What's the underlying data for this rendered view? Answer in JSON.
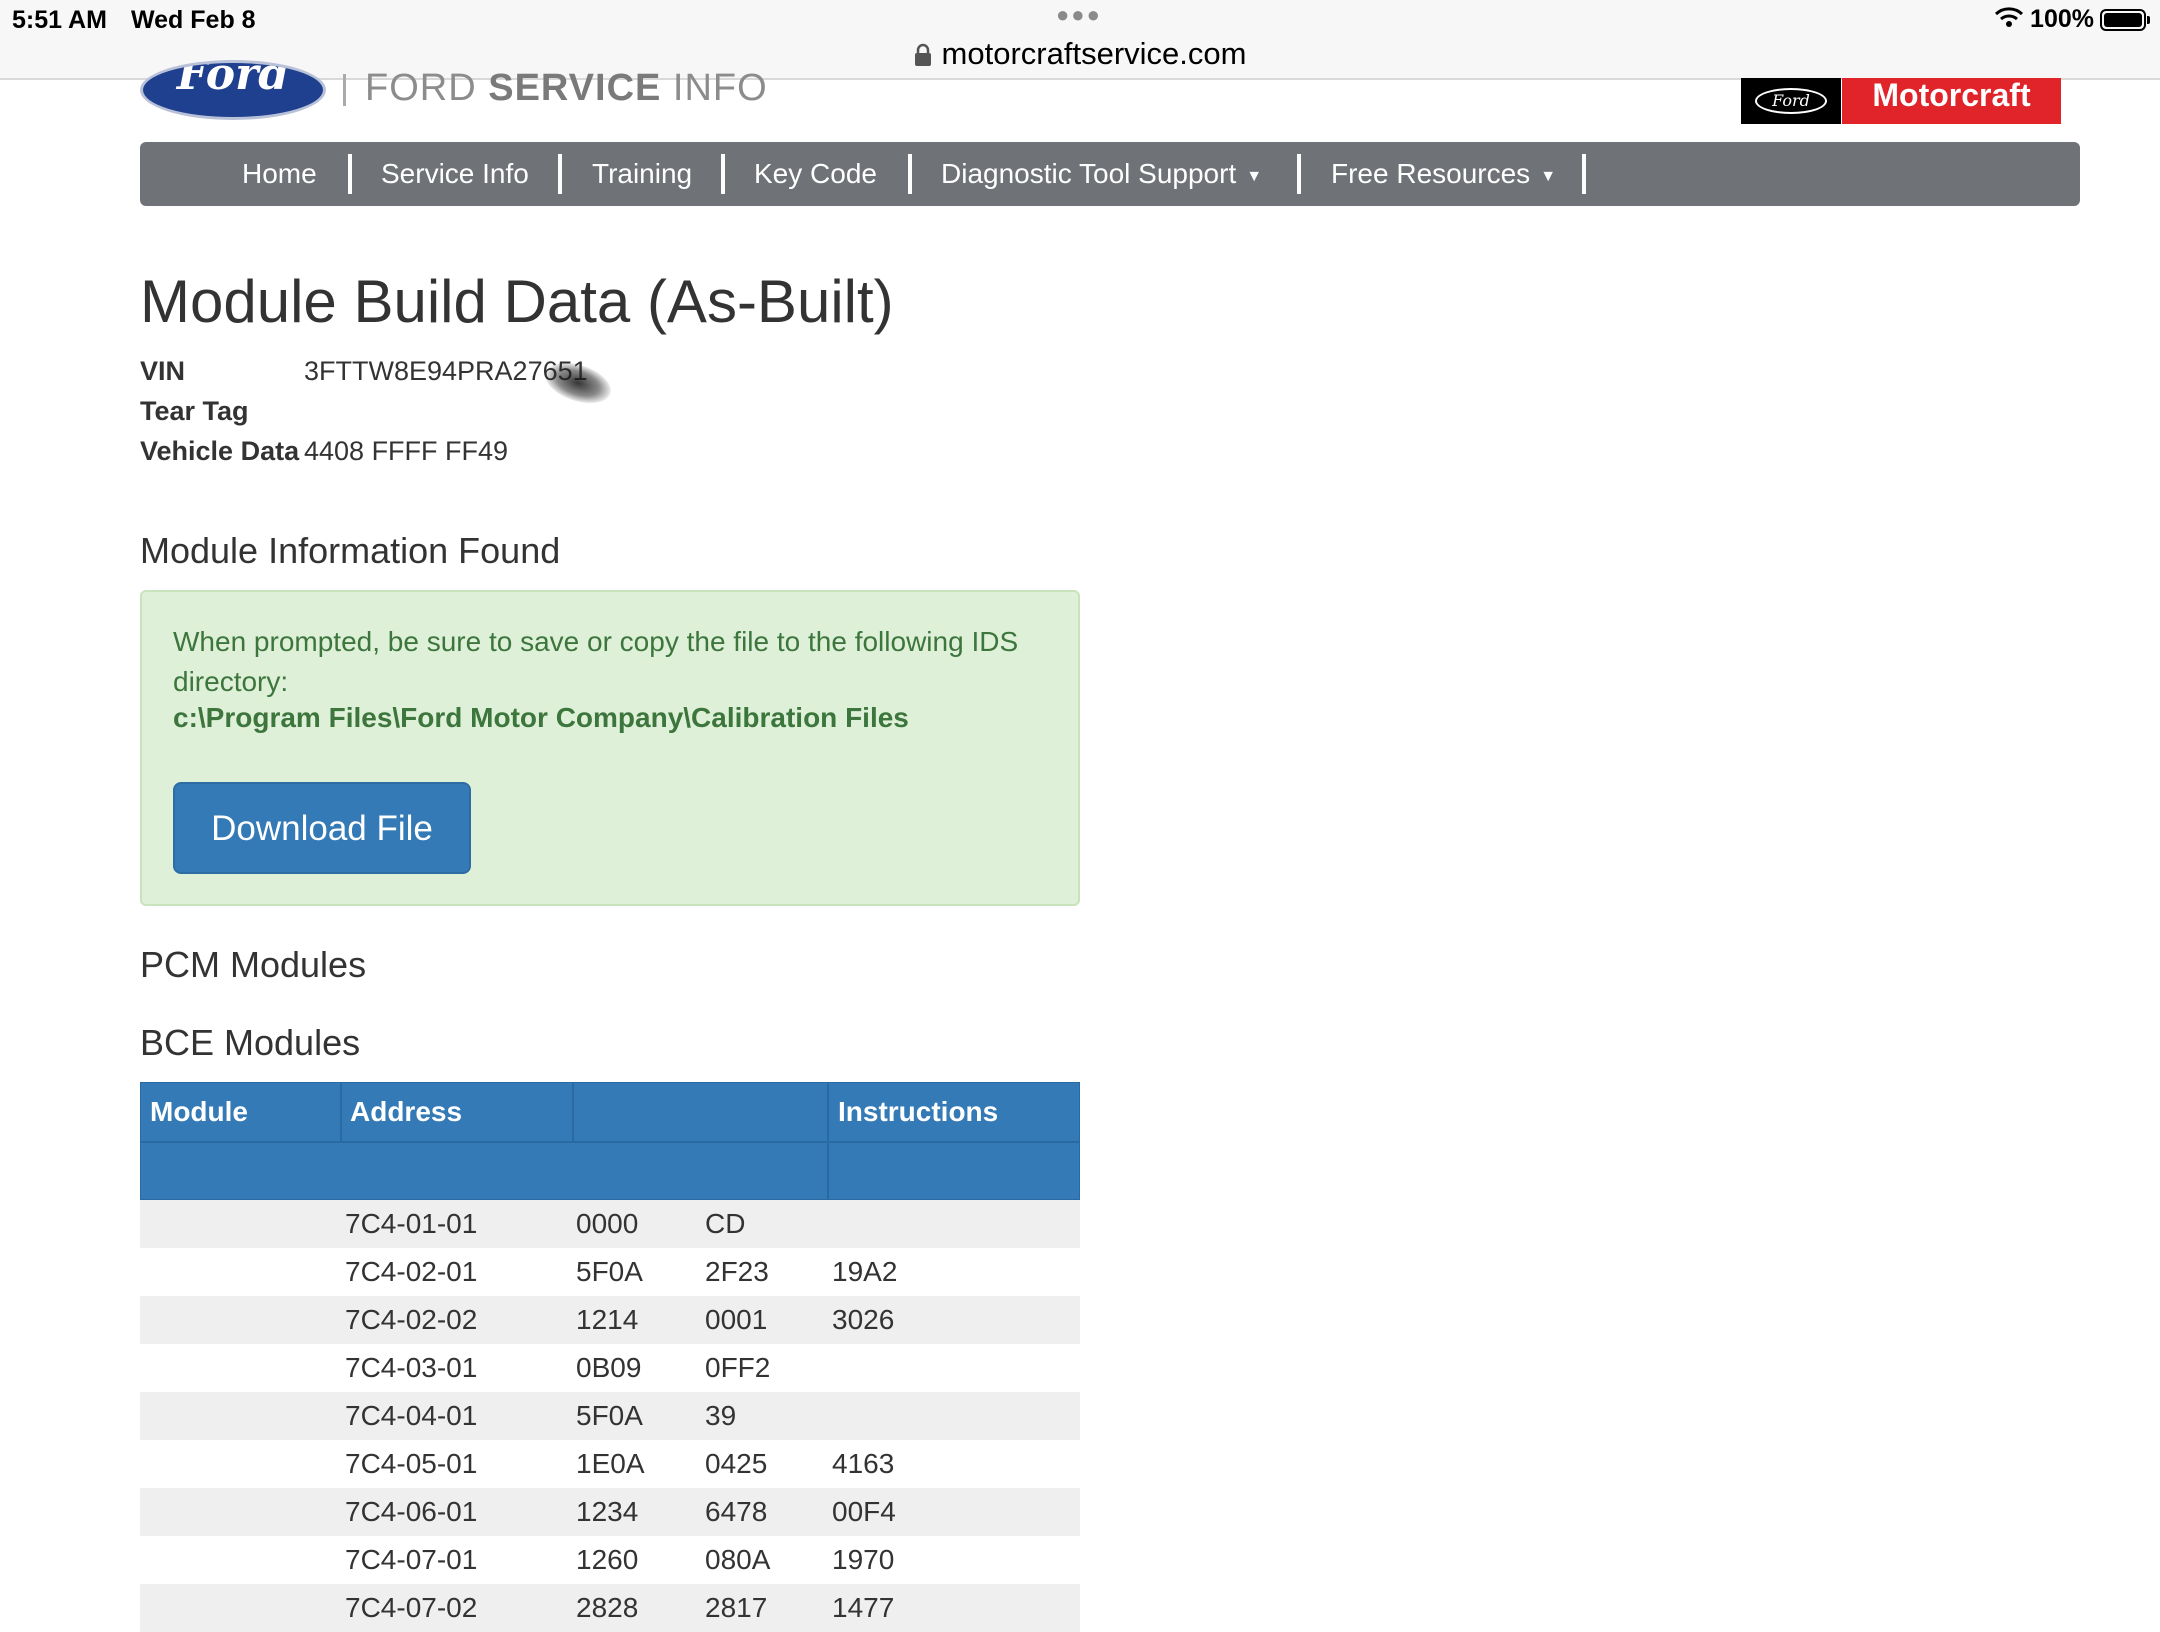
{
  "status_bar": {
    "time": "5:51 AM",
    "date": "Wed Feb 8",
    "url": "motorcraftservice.com",
    "battery_pct": "100%",
    "battery_level": 1.0
  },
  "header": {
    "ford_logo_text": "Ford",
    "site_title_light": "FORD ",
    "site_title_bold": "SERVICE",
    "site_title_end": " INFO",
    "mc_ford_text": "Ford",
    "mc_brand": "Motorcraft"
  },
  "nav": {
    "items": [
      {
        "label": "Home"
      },
      {
        "label": "Service Info"
      },
      {
        "label": "Training"
      },
      {
        "label": "Key Code"
      },
      {
        "label": "Diagnostic Tool Support",
        "caret": "▼"
      },
      {
        "label": "Free Resources",
        "caret": "▼"
      }
    ]
  },
  "page": {
    "title": "Module Build Data (As-Built)",
    "vin_label": "VIN",
    "vin_value": "3FTTW8E94PRA27651",
    "tear_tag_label": "Tear Tag",
    "vehicle_data_label": "Vehicle Data",
    "vehicle_data_value": "4408 FFFF FF49",
    "module_info_heading": "Module Information Found",
    "alert_text": "When prompted, be sure to save or copy the file to the following IDS directory:",
    "alert_path": "c:\\Program Files\\Ford Motor Company\\Calibration Files",
    "download_label": "Download File",
    "pcm_heading": "PCM Modules",
    "bce_heading": "BCE Modules"
  },
  "table": {
    "headers": [
      "Module",
      "Address",
      "",
      "Instructions"
    ],
    "rows": [
      [
        "7C4-01-01",
        "0000",
        "CD",
        ""
      ],
      [
        "7C4-02-01",
        "5F0A",
        "2F23",
        "19A2"
      ],
      [
        "7C4-02-02",
        "1214",
        "0001",
        "3026"
      ],
      [
        "7C4-03-01",
        "0B09",
        "0FF2",
        ""
      ],
      [
        "7C4-04-01",
        "5F0A",
        "39",
        ""
      ],
      [
        "7C4-05-01",
        "1E0A",
        "0425",
        "4163"
      ],
      [
        "7C4-06-01",
        "1234",
        "6478",
        "00F4"
      ],
      [
        "7C4-07-01",
        "1260",
        "080A",
        "1970"
      ],
      [
        "7C4-07-02",
        "2828",
        "2817",
        "1477"
      ]
    ]
  },
  "colors": {
    "nav_bg": "#6f7276",
    "table_header": "#337ab7",
    "button": "#337ab7",
    "alert_bg": "#dff0d8",
    "alert_text": "#3c763d",
    "motorcraft_red": "#e0242a"
  }
}
